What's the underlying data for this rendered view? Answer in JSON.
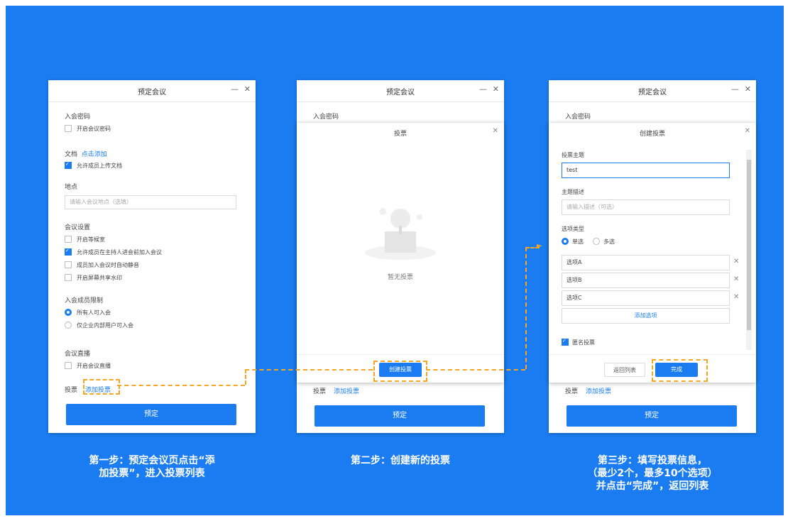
{
  "window_title": "预定会议",
  "step1": {
    "password_label": "入会密码",
    "enable_password": "开启会议密码",
    "docs_label": "文档",
    "docs_add": "点击添加",
    "allow_upload": "允许成员上传文档",
    "location_label": "地点",
    "location_placeholder": "请输入会议地点（选填）",
    "settings_label": "会议设置",
    "waiting_room": "开启等候室",
    "allow_before_host": "允许成员在主持人进会前加入会议",
    "auto_mute": "成员加入会议时自动静音",
    "watermark": "开启屏幕共享水印",
    "member_limit_label": "入会成员限制",
    "all_can_join": "所有人可入会",
    "enterprise_only": "仅企业内部用户可入会",
    "live_label": "会议直播",
    "enable_live": "开启会议直播",
    "vote_label": "投票",
    "add_vote": "添加投票",
    "submit": "预定"
  },
  "step2": {
    "vote_dialog_title": "投票",
    "empty_text": "暂无投票",
    "create_button": "创建投票"
  },
  "step3": {
    "create_title": "创建投票",
    "subject_label": "投票主题",
    "subject_value": "test",
    "desc_label": "主题描述",
    "desc_placeholder": "请输入描述（可选）",
    "option_type_label": "选项类型",
    "single": "单选",
    "multi": "多选",
    "options": [
      "选项A",
      "选项B",
      "选项C"
    ],
    "add_option": "添加选项",
    "anonymous": "匿名投票",
    "back": "返回列表",
    "done": "完成"
  },
  "captions": {
    "step1": [
      "第一步：预定会议页点击“添",
      "加投票”，进入投票列表"
    ],
    "step2": [
      "第二步：创建新的投票"
    ],
    "step3": [
      "第三步：填写投票信息，",
      "（最少2个，最多10个选项）",
      "并点击“完成”，返回列表"
    ]
  },
  "colors": {
    "background": "#1a7cf0",
    "accent": "#1a7cf0",
    "highlight": "#f5a623"
  }
}
